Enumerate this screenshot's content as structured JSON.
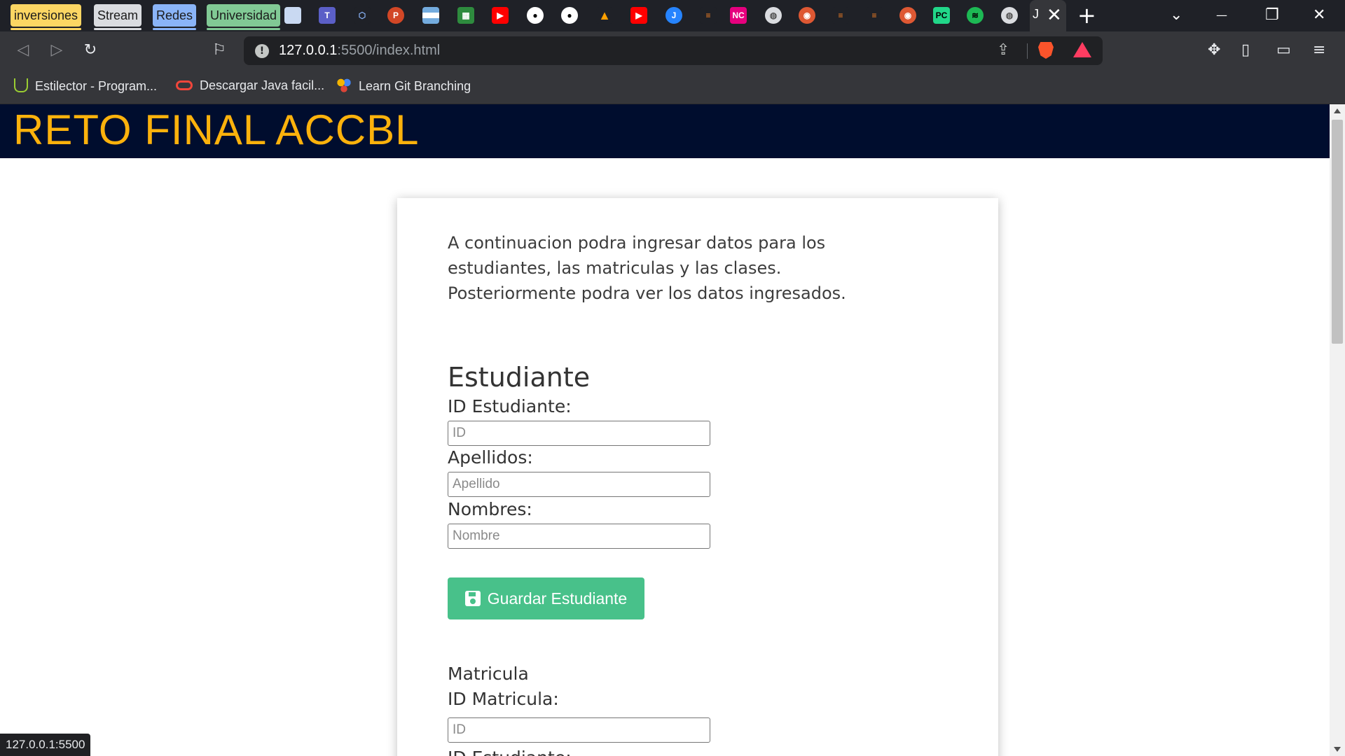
{
  "browser": {
    "tab_groups": [
      {
        "label": "inversiones",
        "color": "#fcd663"
      },
      {
        "label": "Stream",
        "color": "#dadce0"
      },
      {
        "label": "Redes",
        "color": "#8ab4f8"
      },
      {
        "label": "Universidad",
        "color": "#81c995"
      }
    ],
    "mini_tab_icons": [
      "doc-icon",
      "teams-icon",
      "location-icon",
      "powerpoint-icon",
      "argentina-flag-icon",
      "green-app-icon",
      "youtube-icon",
      "github-icon",
      "github-icon",
      "fire-icon",
      "youtube-icon",
      "jira-icon",
      "stack-icon",
      "nc-icon",
      "globe-icon",
      "duckduckgo-icon",
      "stackoverflow-icon",
      "stackoverflow-icon",
      "duckduckgo-icon",
      "pycharm-icon",
      "spotify-icon",
      "globe-icon"
    ],
    "active_tab": {
      "title": "J",
      "close": "✕"
    },
    "new_tab": "+",
    "window_controls": {
      "dropdown": "⌄",
      "minimize": "—",
      "restore": "❐",
      "close": "✕"
    },
    "url": {
      "host": "127.0.0.1",
      "path": ":5500/index.html"
    },
    "bookmarks": [
      {
        "label": "Estilector - Program...",
        "icon": "estilector-icon"
      },
      {
        "label": "Descargar Java facil...",
        "icon": "oracle-icon"
      },
      {
        "label": "Learn Git Branching",
        "icon": "git-branching-icon"
      }
    ],
    "status_url": "127.0.0.1:5500",
    "colors": {
      "tabstrip": "#1f2127",
      "toolbar": "#35363a"
    }
  },
  "page": {
    "header_title": "RETO FINAL ACCBL",
    "intro": "A continuacion podra ingresar datos para los estudiantes, las matriculas y las clases. Posteriormente podra ver los datos ingresados.",
    "estudiante": {
      "title": "Estudiante",
      "id_label": "ID Estudiante:",
      "id_placeholder": "ID",
      "apellidos_label": "Apellidos:",
      "apellidos_placeholder": "Apellido",
      "nombres_label": "Nombres:",
      "nombres_placeholder": "Nombre",
      "save_button": "Guardar Estudiante"
    },
    "matricula": {
      "title": "Matricula",
      "id_label": "ID Matricula:",
      "id_placeholder": "ID",
      "student_id_label": "ID Estudiante:"
    },
    "colors": {
      "header_bg": "#000d2e",
      "header_text": "#fcb20c",
      "button": "#48c18a"
    }
  }
}
